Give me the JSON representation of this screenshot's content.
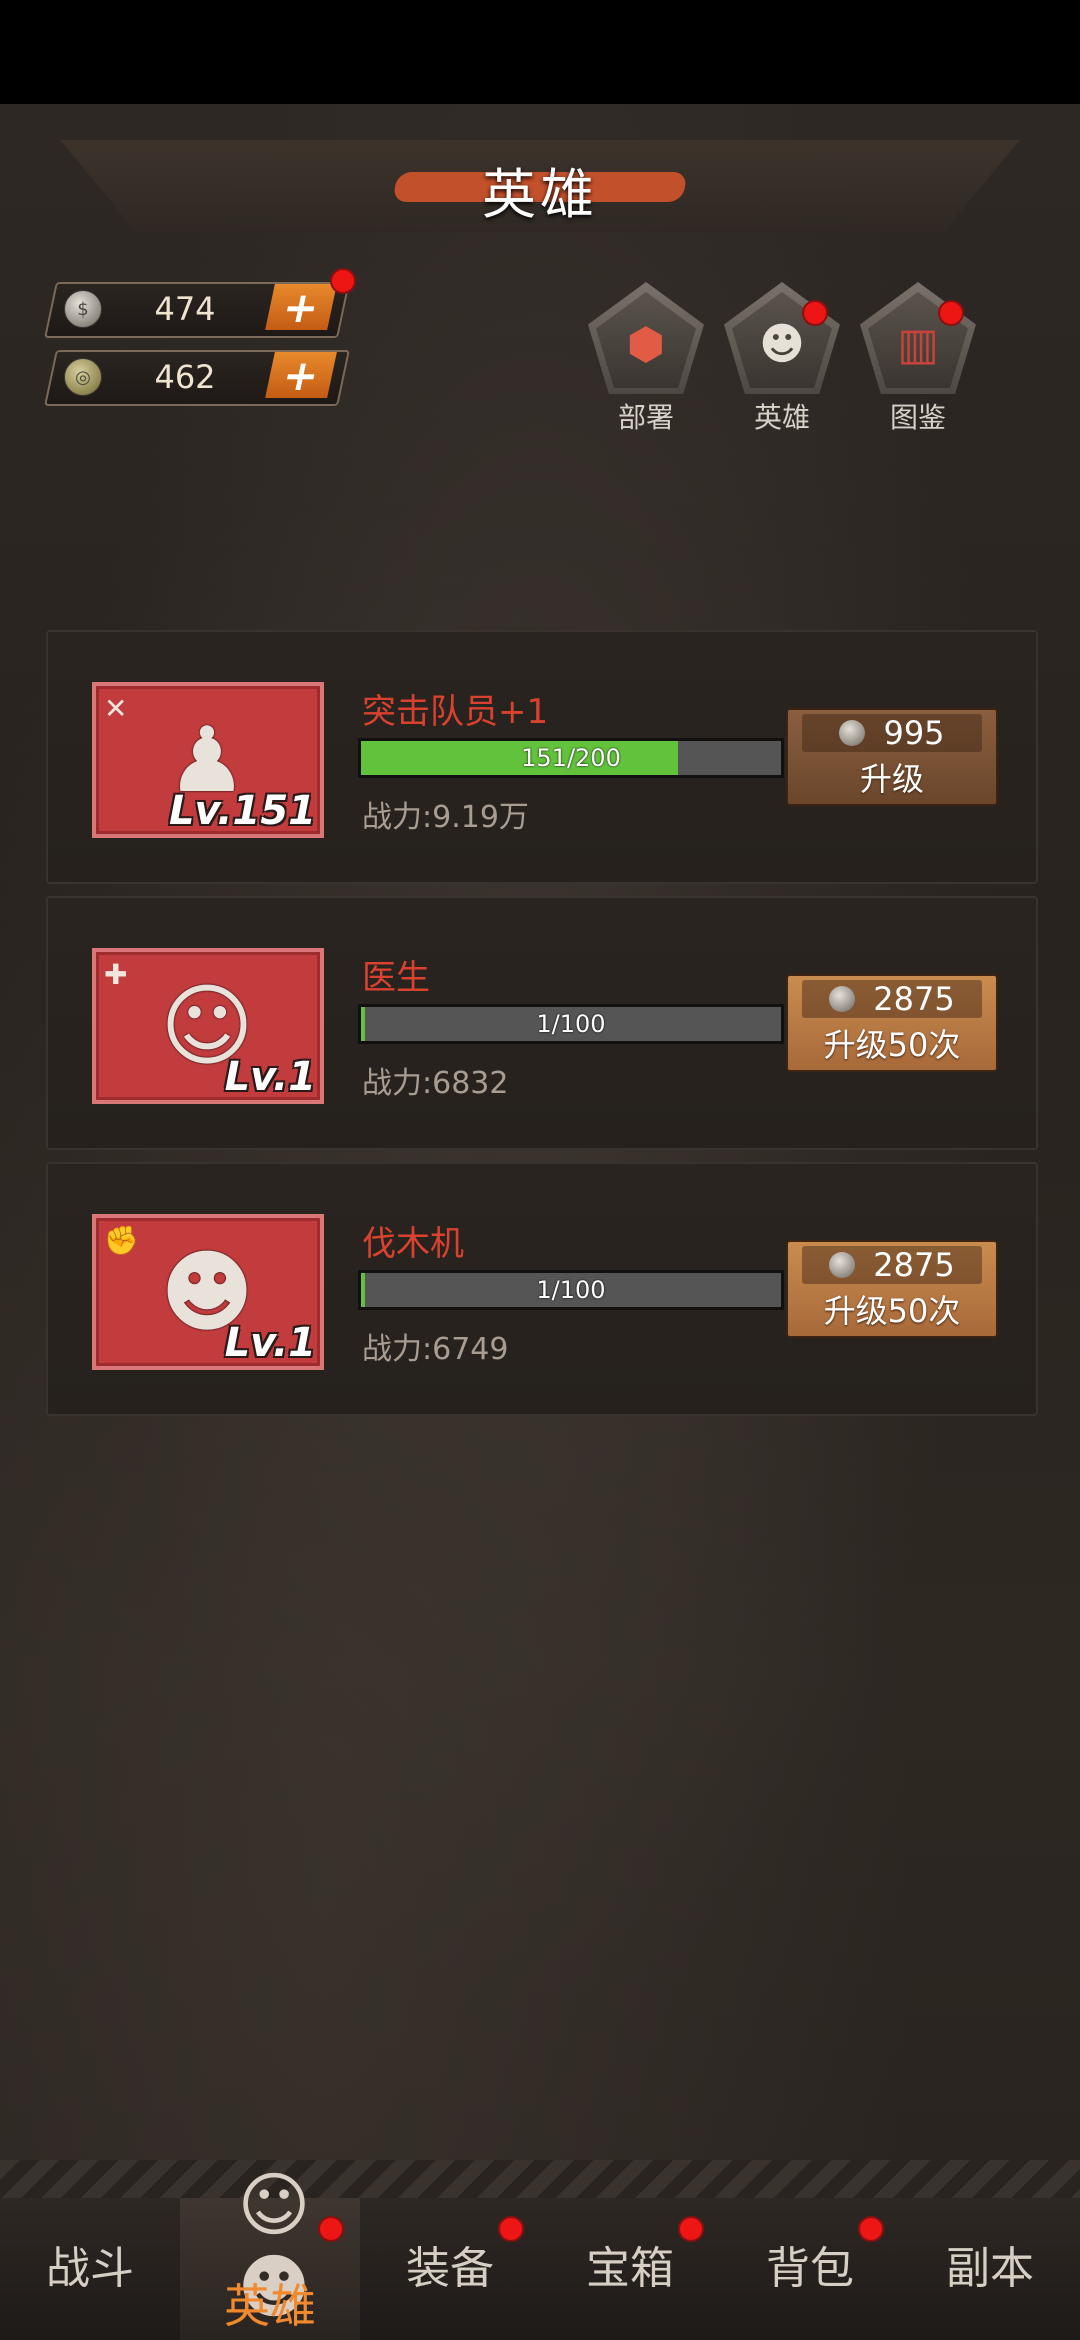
{
  "header": {
    "title": "英雄"
  },
  "currencies": [
    {
      "amount": "474",
      "icon": "silver-coin-icon",
      "plus_icon": "+"
    },
    {
      "amount": "462",
      "icon": "gold-coin-icon",
      "plus_icon": "+"
    }
  ],
  "tools": [
    {
      "label": "部署",
      "icon": "deploy-icon",
      "glyph": "⬢"
    },
    {
      "label": "英雄",
      "icon": "hero-icon",
      "glyph": "☻"
    },
    {
      "label": "图鉴",
      "icon": "codex-icon",
      "glyph": "▥"
    }
  ],
  "heroes": [
    {
      "name": "突击队员+1",
      "level_text": "Lv.151",
      "progress_text": "151/200",
      "progress": 0.755,
      "power": "战力:9.19万",
      "cost": "995",
      "action": "升级",
      "role_glyph": "✕",
      "figure_glyph": "♟"
    },
    {
      "name": "医生",
      "level_text": "Lv.1",
      "progress_text": "1/100",
      "progress": 0.01,
      "power": "战力:6832",
      "cost": "2875",
      "action": "升级50次",
      "role_glyph": "✚",
      "figure_glyph": "☺"
    },
    {
      "name": "伐木机",
      "level_text": "Lv.1",
      "progress_text": "1/100",
      "progress": 0.01,
      "power": "战力:6749",
      "cost": "2875",
      "action": "升级50次",
      "role_glyph": "✊",
      "figure_glyph": "☻"
    }
  ],
  "nav": [
    {
      "label": "战斗"
    },
    {
      "label": "英雄"
    },
    {
      "label": "装备"
    },
    {
      "label": "宝箱"
    },
    {
      "label": "背包"
    },
    {
      "label": "副本"
    }
  ],
  "colors": {
    "accent": "#f18a2e",
    "name_red": "#d9422f",
    "progress_green": "#62c23c",
    "badge_red": "#ee1515"
  }
}
